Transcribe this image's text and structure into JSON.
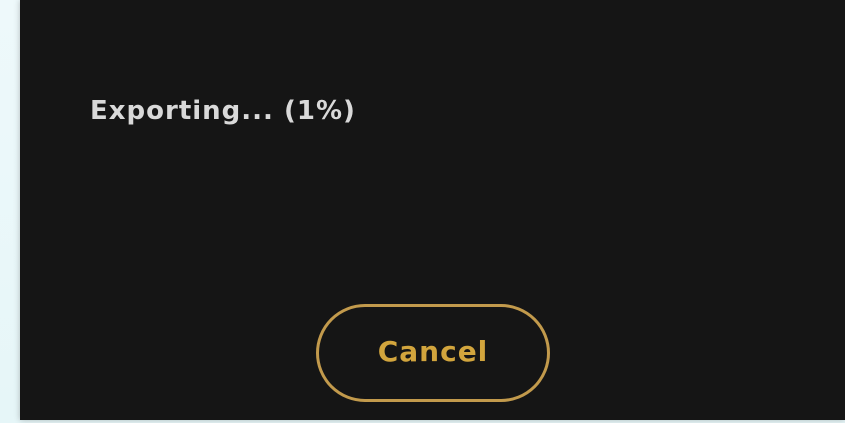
{
  "export_dialog": {
    "status_text": "Exporting... (1%)",
    "progress_percent": 1,
    "cancel_label": "Cancel"
  },
  "colors": {
    "dialog_background": "#151515",
    "status_text": "#d9d9d9",
    "accent": "#d2a53d",
    "button_border": "#c29a4c",
    "page_background": "#e9f7f9"
  }
}
